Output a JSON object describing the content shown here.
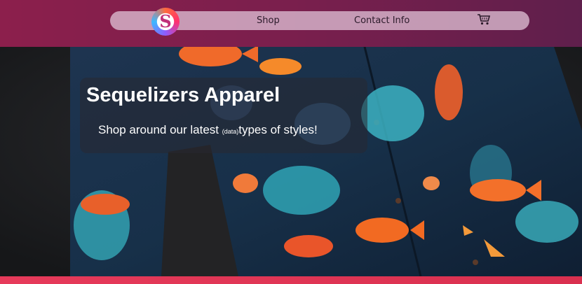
{
  "header": {
    "logo_letter": "S",
    "nav": {
      "shop": "Shop",
      "contact": "Contact Info"
    },
    "cart_icon": "shopping-cart-icon",
    "colors": {
      "bar": "#7a1f4d",
      "nav_pill": "#dcbed2"
    }
  },
  "hero": {
    "title": "Sequelizers Apparel",
    "subtitle_pre": "Shop around our latest ",
    "subtitle_tag": "(data)",
    "subtitle_post": "types of styles!"
  }
}
